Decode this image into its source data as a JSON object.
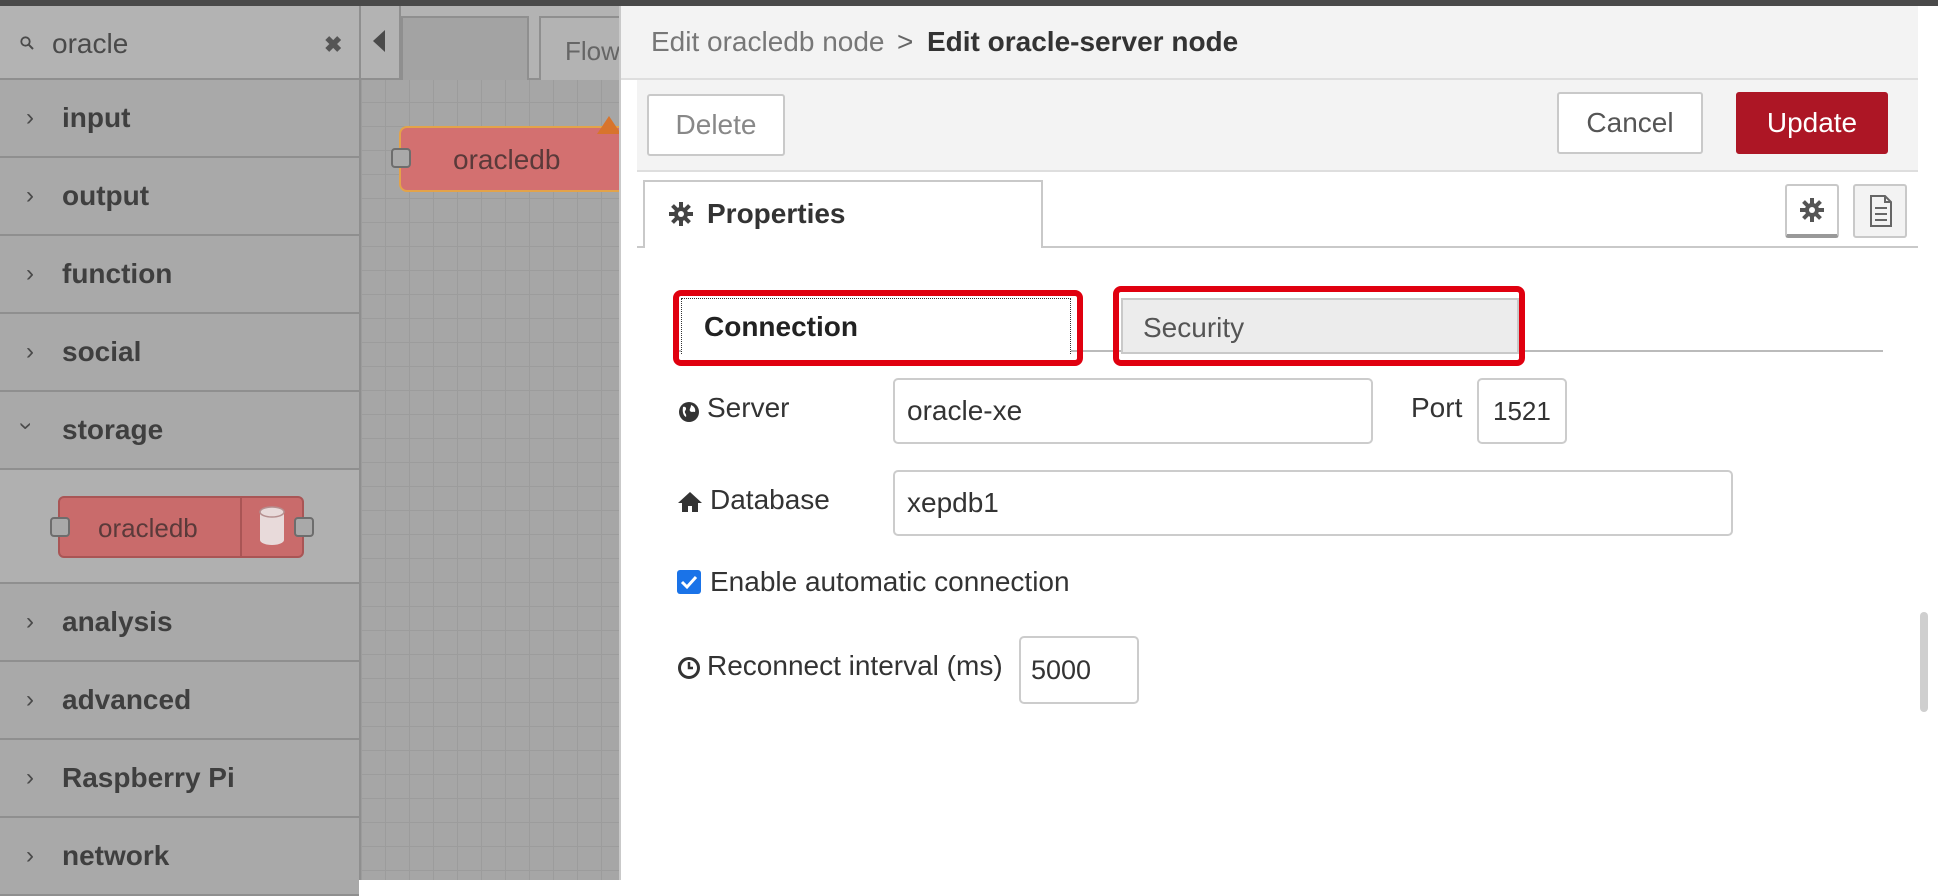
{
  "palette": {
    "search_value": "oracle",
    "clear_glyph": "✖",
    "categories": [
      {
        "label": "input",
        "expanded": false
      },
      {
        "label": "output",
        "expanded": false
      },
      {
        "label": "function",
        "expanded": false
      },
      {
        "label": "social",
        "expanded": false
      },
      {
        "label": "storage",
        "expanded": true,
        "nodes": [
          {
            "label": "oracledb"
          }
        ]
      },
      {
        "label": "analysis",
        "expanded": false
      },
      {
        "label": "advanced",
        "expanded": false
      },
      {
        "label": "Raspberry Pi",
        "expanded": false
      },
      {
        "label": "network",
        "expanded": false
      }
    ]
  },
  "workspace": {
    "tabs": [
      {
        "label": ""
      },
      {
        "label": "Flow"
      }
    ],
    "node": {
      "label": "oracledb",
      "has_warning": true
    }
  },
  "tray": {
    "breadcrumb_prev": "Edit oracledb node",
    "breadcrumb_sep": ">",
    "breadcrumb_current": "Edit oracle-server node",
    "delete_label": "Delete",
    "cancel_label": "Cancel",
    "update_label": "Update",
    "properties_tab": "Properties",
    "subtabs": [
      {
        "label": "Connection",
        "active": true
      },
      {
        "label": "Security",
        "active": false
      }
    ],
    "fields": {
      "server_label": "Server",
      "server_value": "oracle-xe",
      "port_label": "Port",
      "port_value": "1521",
      "database_label": "Database",
      "database_value": "xepdb1",
      "auto_connect_label": "Enable automatic connection",
      "auto_connect_checked": true,
      "reconnect_label": "Reconnect interval (ms)",
      "reconnect_value": "5000"
    }
  },
  "colors": {
    "update_button": "#ad1625",
    "highlight": "#e0000f",
    "node_fill": "#d37070",
    "checkbox": "#1a73e8"
  },
  "icons": [
    "search-icon",
    "clear-icon",
    "chevron-right-icon",
    "chevron-down-icon",
    "database-icon",
    "warning-icon",
    "scroll-left-icon",
    "gear-icon",
    "document-icon",
    "globe-icon",
    "home-icon",
    "clock-icon",
    "checkbox-checked-icon"
  ]
}
